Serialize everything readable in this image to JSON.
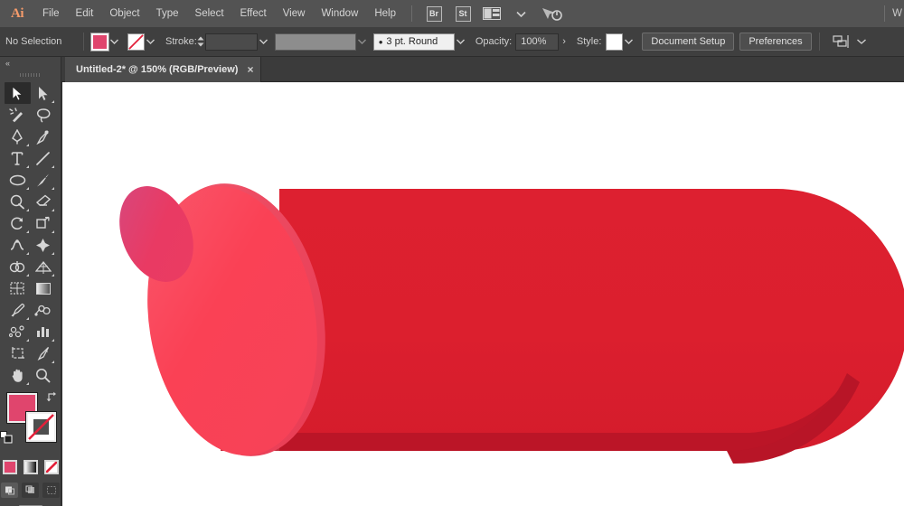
{
  "app": {
    "name": "Adobe Illustrator",
    "logo_text": "Ai"
  },
  "menubar": {
    "items": [
      {
        "label": "File"
      },
      {
        "label": "Edit"
      },
      {
        "label": "Object"
      },
      {
        "label": "Type"
      },
      {
        "label": "Select"
      },
      {
        "label": "Effect"
      },
      {
        "label": "View"
      },
      {
        "label": "Window"
      },
      {
        "label": "Help"
      }
    ],
    "bridge_badge": "Br",
    "stock_badge": "St",
    "arrange_icon": "arrange-documents-icon",
    "arrange_caret": "chevron-down-icon",
    "cursor_icon": "cursor-sync-icon",
    "workspace_label": "W"
  },
  "controlbar": {
    "selection_status": "No Selection",
    "fill_label": "fill-swatch",
    "fill_color": "#E0456D",
    "stroke_label": "stroke-swatch",
    "stroke_color": "none",
    "stroke_text": "Stroke:",
    "stroke_weight_value": "",
    "width_profile_value": "",
    "brush_definition": "3 pt. Round",
    "opacity_text": "Opacity:",
    "opacity_value": "100%",
    "style_text": "Style:",
    "style_swatch_color": "#FFFFFF",
    "document_setup_label": "Document Setup",
    "preferences_label": "Preferences",
    "align_icon": "align-objects-icon"
  },
  "tabbar": {
    "document_title": "Untitled-2* @ 150% (RGB/Preview)",
    "close_glyph": "×"
  },
  "toolbar": {
    "collapse_glyph": "«",
    "tools": [
      {
        "name": "selection-tool",
        "active": true,
        "corner": false
      },
      {
        "name": "direct-selection-tool",
        "active": false,
        "corner": true
      },
      {
        "name": "magic-wand-tool",
        "active": false,
        "corner": false
      },
      {
        "name": "lasso-tool",
        "active": false,
        "corner": false
      },
      {
        "name": "pen-tool",
        "active": false,
        "corner": true
      },
      {
        "name": "curvature-tool",
        "active": false,
        "corner": false
      },
      {
        "name": "type-tool",
        "active": false,
        "corner": true
      },
      {
        "name": "line-segment-tool",
        "active": false,
        "corner": true
      },
      {
        "name": "ellipse-tool",
        "active": false,
        "corner": true
      },
      {
        "name": "paintbrush-tool",
        "active": false,
        "corner": true
      },
      {
        "name": "shaper-tool",
        "active": false,
        "corner": true
      },
      {
        "name": "eraser-tool",
        "active": false,
        "corner": true
      },
      {
        "name": "rotate-tool",
        "active": false,
        "corner": true
      },
      {
        "name": "scale-tool",
        "active": false,
        "corner": true
      },
      {
        "name": "width-tool",
        "active": false,
        "corner": true
      },
      {
        "name": "free-transform-tool",
        "active": false,
        "corner": true
      },
      {
        "name": "shape-builder-tool",
        "active": false,
        "corner": true
      },
      {
        "name": "perspective-grid-tool",
        "active": false,
        "corner": true
      },
      {
        "name": "mesh-tool",
        "active": false,
        "corner": false
      },
      {
        "name": "gradient-tool",
        "active": false,
        "corner": false
      },
      {
        "name": "eyedropper-tool",
        "active": false,
        "corner": true
      },
      {
        "name": "blend-tool",
        "active": false,
        "corner": false
      },
      {
        "name": "symbol-sprayer-tool",
        "active": false,
        "corner": true
      },
      {
        "name": "column-graph-tool",
        "active": false,
        "corner": true
      },
      {
        "name": "artboard-tool",
        "active": false,
        "corner": false
      },
      {
        "name": "slice-tool",
        "active": false,
        "corner": true
      },
      {
        "name": "hand-tool",
        "active": false,
        "corner": true
      },
      {
        "name": "zoom-tool",
        "active": false,
        "corner": false
      }
    ],
    "fill_color": "#E0456D",
    "stroke_color": "#FFFFFF",
    "stroke_is_none": true,
    "swap_icon": "swap-fill-stroke-icon",
    "default_icon": "default-fill-stroke-icon",
    "modes": [
      {
        "name": "color-mode-button",
        "label": "Color"
      },
      {
        "name": "gradient-mode-button",
        "label": "Gradient"
      },
      {
        "name": "none-mode-button",
        "label": "None"
      }
    ],
    "draw_modes": [
      {
        "name": "draw-normal-button",
        "active": true
      },
      {
        "name": "draw-behind-button",
        "active": false
      },
      {
        "name": "draw-inside-button",
        "active": false
      }
    ],
    "screen_mode": "change-screen-mode-button"
  },
  "artwork": {
    "description": "3D red cylinder / tube illustration",
    "body_color": "#DC1F2E",
    "body_shadow_color": "#B81527",
    "face_color": "#FA4155",
    "face_rim_color": "#F2566B",
    "hole_color": "#E93A63",
    "hole_shadow_color": "#D23A68",
    "canvas_background": "#FFFFFF"
  }
}
